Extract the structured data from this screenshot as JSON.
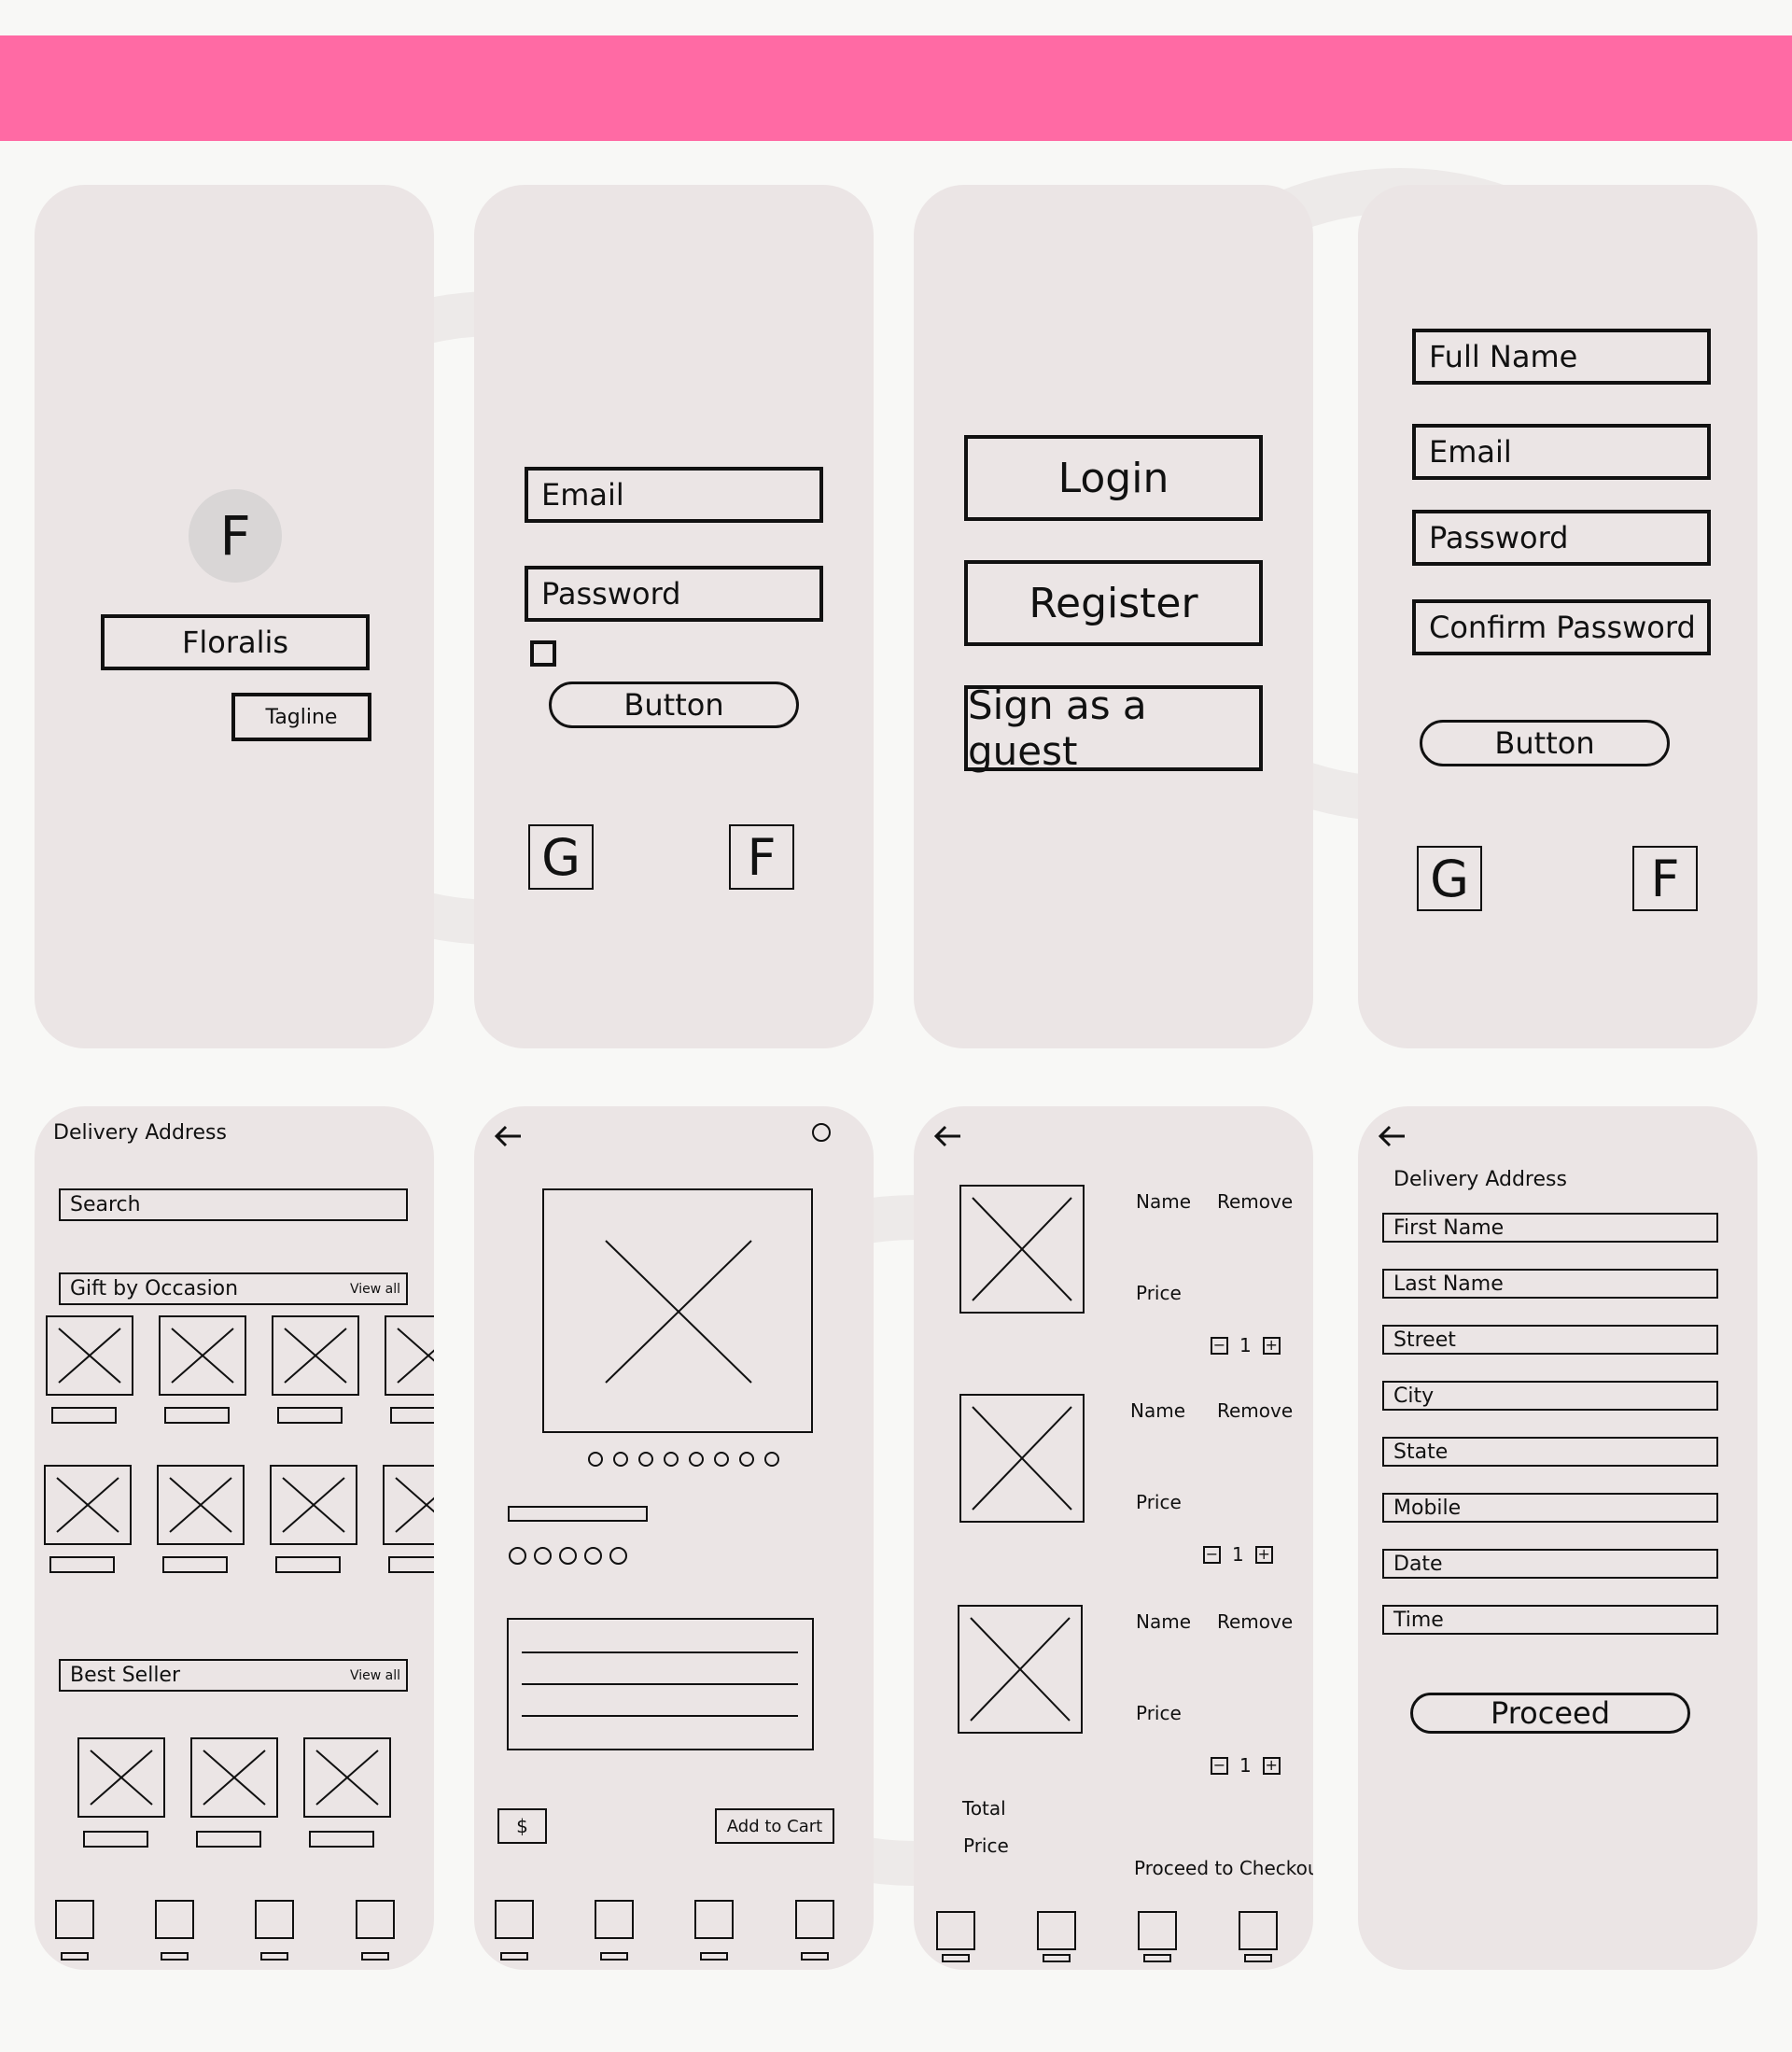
{
  "splash": {
    "logo_letter": "F",
    "brand": "Floralis",
    "tagline": "Tagline"
  },
  "login_form": {
    "email": "Email",
    "password": "Password",
    "button": "Button",
    "google": "G",
    "facebook": "F"
  },
  "auth_choice": {
    "login": "Login",
    "register": "Register",
    "guest": "Sign as a guest"
  },
  "register_form": {
    "full_name": "Full Name",
    "email": "Email",
    "password": "Password",
    "confirm_password": "Confirm Password",
    "button": "Button",
    "google": "G",
    "facebook": "F"
  },
  "home": {
    "header": "Delivery Address",
    "search": "Search",
    "occasion": "Gift by Occasion",
    "occasion_view_all": "View all",
    "best_seller": "Best Seller",
    "best_view_all": "View all"
  },
  "product": {
    "price_symbol": "$",
    "add_to_cart": "Add to Cart"
  },
  "cart": {
    "items": [
      {
        "name": "Name",
        "remove": "Remove",
        "price": "Price",
        "qty": "1"
      },
      {
        "name": "Name",
        "remove": "Remove",
        "price": "Price",
        "qty": "1"
      },
      {
        "name": "Name",
        "remove": "Remove",
        "price": "Price",
        "qty": "1"
      }
    ],
    "total_1": "Total",
    "total_2": "Price",
    "checkout": "Proceed to Checkout"
  },
  "delivery": {
    "title": "Delivery Address",
    "fields": [
      "First Name",
      "Last Name",
      "Street",
      "City",
      "State",
      "Mobile",
      "Date",
      "Time"
    ],
    "proceed": "Proceed"
  },
  "icons": {
    "back": "arrow-left-icon",
    "minus": "minus-icon",
    "plus": "plus-icon",
    "placeholder": "image-placeholder-icon"
  },
  "colors": {
    "banner": "#ff6aa4",
    "phone_bg": "#ebe5e5",
    "page_bg": "#f8f8f6"
  }
}
